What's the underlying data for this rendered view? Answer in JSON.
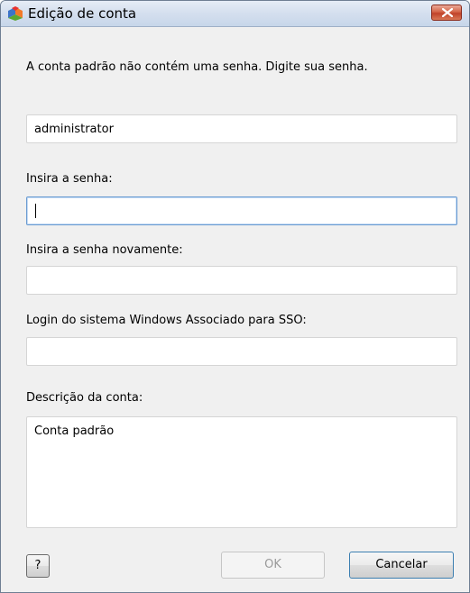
{
  "window": {
    "title": "Edição de conta"
  },
  "message": "A conta padrão não contém uma senha. Digite sua senha.",
  "username": {
    "value": "administrator"
  },
  "password": {
    "label": "Insira a senha:",
    "value": ""
  },
  "password_confirm": {
    "label": "Insira a senha novamente:",
    "value": ""
  },
  "sso_login": {
    "label": "Login do sistema Windows Associado para SSO:",
    "value": ""
  },
  "description": {
    "label": "Descrição da conta:",
    "value": "Conta padrão"
  },
  "buttons": {
    "help": "?",
    "ok": "OK",
    "cancel": "Cancelar"
  },
  "colors": {
    "close_button": "#c0422a",
    "focus_border": "#6a9bd1"
  }
}
